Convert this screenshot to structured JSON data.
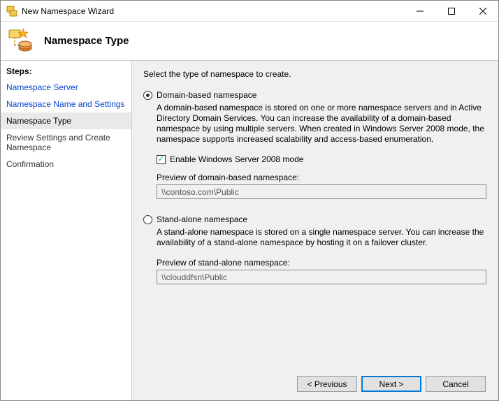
{
  "window": {
    "title": "New Namespace Wizard"
  },
  "header": {
    "title": "Namespace Type"
  },
  "sidebar": {
    "heading": "Steps:",
    "steps": [
      {
        "label": "Namespace Server"
      },
      {
        "label": "Namespace Name and Settings"
      },
      {
        "label": "Namespace Type"
      },
      {
        "label": "Review Settings and Create Namespace"
      },
      {
        "label": "Confirmation"
      }
    ]
  },
  "main": {
    "instruction": "Select the type of namespace to create.",
    "option1": {
      "label": "Domain-based namespace",
      "desc": "A domain-based namespace is stored on one or more namespace servers and in Active Directory Domain Services. You can increase the availability of a domain-based namespace by using multiple servers. When created in Windows Server 2008 mode, the namespace supports increased scalability and access-based enumeration.",
      "checkbox_label": "Enable Windows Server 2008 mode",
      "preview_label": "Preview of domain-based namespace:",
      "preview_value": "\\\\contoso.com\\Public"
    },
    "option2": {
      "label": "Stand-alone namespace",
      "desc": "A stand-alone namespace is stored on a single namespace server. You can increase the availability of a stand-alone namespace by hosting it on a failover cluster.",
      "preview_label": "Preview of stand-alone namespace:",
      "preview_value": "\\\\clouddfsn\\Public"
    }
  },
  "buttons": {
    "previous": "< Previous",
    "next": "Next >",
    "cancel": "Cancel"
  }
}
